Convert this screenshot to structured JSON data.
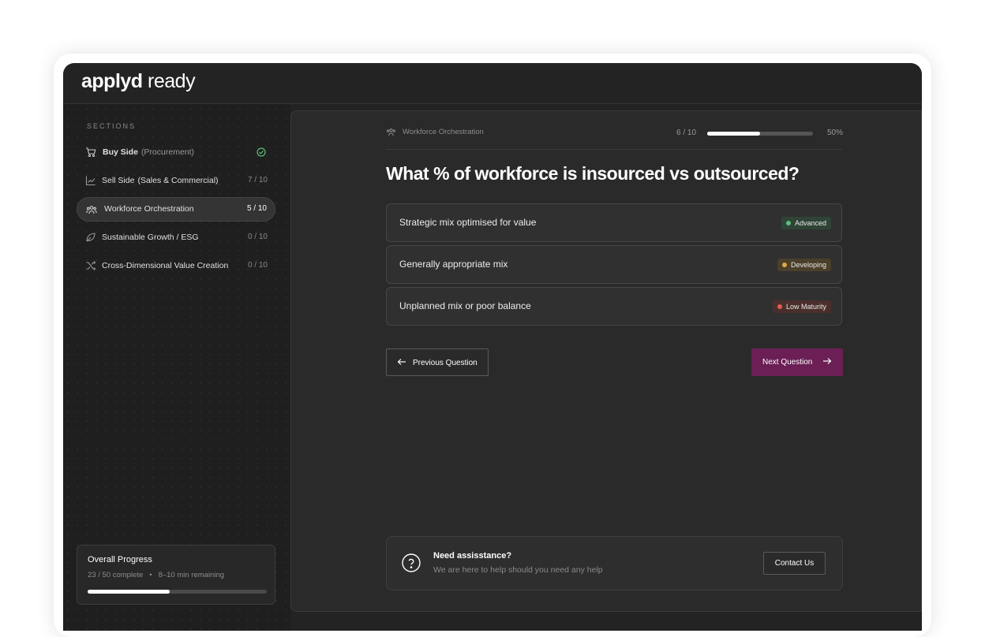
{
  "app": {
    "logo_bold": "applyd",
    "logo_light": "ready"
  },
  "sidebar": {
    "title": "SECTIONS",
    "items": [
      {
        "label": "Buy Side",
        "sub": "(Procurement)",
        "count": "",
        "icon": "cart-icon",
        "status": "complete"
      },
      {
        "label": "Sell Side",
        "sub": "(Sales & Commercial)",
        "count": "7 / 10",
        "icon": "chart-line-icon",
        "status": "in-progress"
      },
      {
        "label": "Workforce Orchestration",
        "sub": "",
        "count": "5 / 10",
        "icon": "people-icon",
        "status": "active"
      },
      {
        "label": "Sustainable Growth / ESG",
        "sub": "",
        "count": "0 / 10",
        "icon": "leaf-icon",
        "status": "not-started"
      },
      {
        "label": "Cross-Dimensional Value Creation",
        "sub": "",
        "count": "0 / 10",
        "icon": "shuffle-icon",
        "status": "not-started"
      }
    ],
    "overall": {
      "title": "Overall Progress",
      "complete": "23 / 50 complete",
      "dot": "•",
      "remaining": "8–10 min remaining",
      "fraction": 0.46
    }
  },
  "main": {
    "breadcrumb": "Workforce Orchestration",
    "progress_text": "6 / 10",
    "progress_fraction": 0.5,
    "progress_pct": "50%",
    "question": "What % of workforce is insourced vs outsourced?",
    "options": [
      {
        "text": "Strategic mix optimised for value",
        "badge": "Advanced",
        "badge_bg": "#2f4436",
        "dot": "#5bbf7a"
      },
      {
        "text": "Generally appropriate mix",
        "badge": "Developing",
        "badge_bg": "#4a3f2a",
        "dot": "#e0a847"
      },
      {
        "text": "Unplanned mix or poor balance",
        "badge": "Low Maturity",
        "badge_bg": "#4a2f2c",
        "dot": "#e0604f"
      }
    ],
    "prev_label": "Previous Question",
    "next_label": "Next Question",
    "help": {
      "title": "Need assisstance?",
      "subtitle": "We are here to help should you need any help",
      "contact": "Contact Us"
    }
  },
  "colors": {
    "accent": "#6b1f55",
    "success": "#5bbf7a"
  }
}
